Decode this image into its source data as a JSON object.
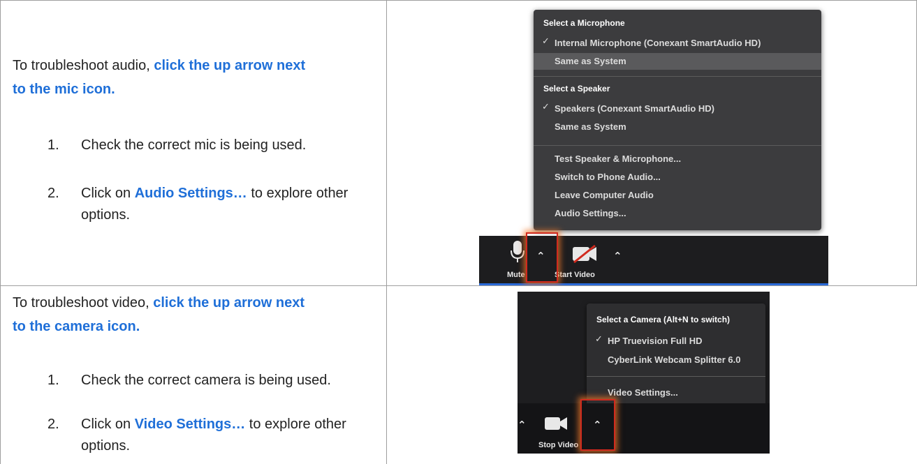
{
  "audio": {
    "intro_text": "To troubleshoot audio, ",
    "intro_highlight": "click the up arrow next to the mic icon.",
    "steps": [
      {
        "num": "1.",
        "text": "Check the correct mic is being used."
      },
      {
        "num": "2.",
        "pre": "Click on ",
        "highlight": "Audio Settings…",
        "post": " to explore other options."
      }
    ],
    "menu": {
      "mic_header": "Select a Microphone",
      "mic_items": [
        "Internal Microphone (Conexant SmartAudio HD)",
        "Same as System"
      ],
      "speaker_header": "Select a Speaker",
      "speaker_items": [
        "Speakers (Conexant SmartAudio HD)",
        "Same as System"
      ],
      "actions": [
        "Test Speaker & Microphone...",
        "Switch to Phone Audio...",
        "Leave Computer Audio",
        "Audio Settings..."
      ],
      "check": "✓"
    },
    "toolbar": {
      "mute_label": "Mute",
      "video_label": "Start Video"
    }
  },
  "video": {
    "intro_text": "To troubleshoot video, ",
    "intro_highlight": "click the up arrow next to the camera icon.",
    "steps": [
      {
        "num": "1.",
        "text": "Check the correct camera is being used."
      },
      {
        "num": "2.",
        "pre": "Click on ",
        "highlight": "Video Settings…",
        "post": " to explore other options."
      }
    ],
    "menu": {
      "header": "Select a Camera (Alt+N to switch)",
      "items": [
        "HP Truevision Full HD",
        "CyberLink Webcam Splitter 6.0"
      ],
      "action": "Video Settings...",
      "check": "✓"
    },
    "toolbar": {
      "video_label": "Stop Video"
    }
  },
  "colors": {
    "accent": "#1f6fd8",
    "menu_bg": "#3c3c3e",
    "toolbar_bg": "#1d1d1f",
    "highlight": "#d12a1e"
  }
}
